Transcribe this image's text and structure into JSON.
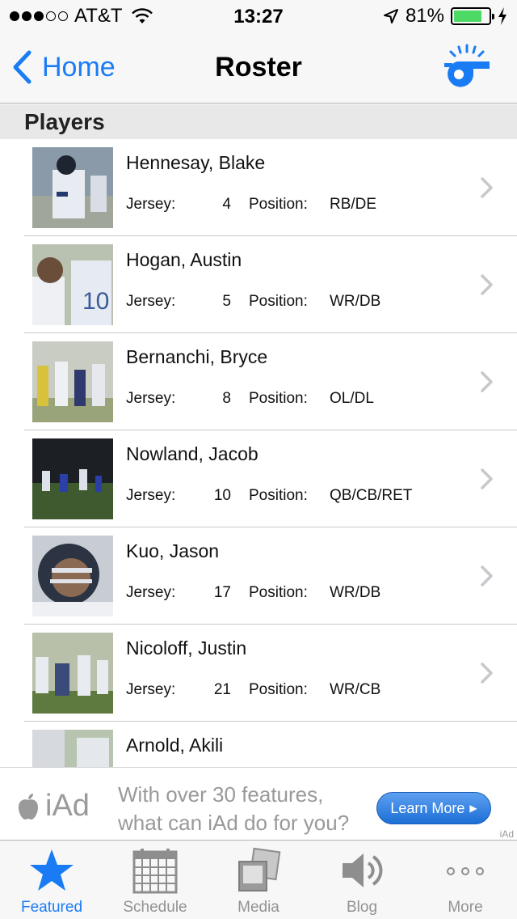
{
  "status_bar": {
    "carrier": "AT&T",
    "time": "13:27",
    "battery_percent": "81%",
    "battery_level": 0.81,
    "signal_bars": 3,
    "signal_total": 5
  },
  "nav": {
    "back_label": "Home",
    "title": "Roster",
    "right_icon": "whistle-icon",
    "accent_color": "#1a7cf5"
  },
  "section": {
    "title": "Players"
  },
  "labels": {
    "jersey": "Jersey:",
    "position": "Position:"
  },
  "players": [
    {
      "name": "Hennesay, Blake",
      "jersey": "4",
      "position": "RB/DE"
    },
    {
      "name": "Hogan, Austin",
      "jersey": "5",
      "position": "WR/DB"
    },
    {
      "name": "Bernanchi, Bryce",
      "jersey": "8",
      "position": "OL/DL"
    },
    {
      "name": "Nowland, Jacob",
      "jersey": "10",
      "position": "QB/CB/RET"
    },
    {
      "name": "Kuo, Jason",
      "jersey": "17",
      "position": "WR/DB"
    },
    {
      "name": "Nicoloff, Justin",
      "jersey": "21",
      "position": "WR/CB"
    },
    {
      "name": "Arnold, Akili",
      "jersey": "",
      "position": ""
    }
  ],
  "ad": {
    "brand": "iAd",
    "text": "With over 30 features, what can iAd do for you?",
    "button_label": "Learn More",
    "tag": "iAd"
  },
  "tabs": [
    {
      "label": "Featured",
      "icon": "star-icon",
      "active": true
    },
    {
      "label": "Schedule",
      "icon": "calendar-icon",
      "active": false
    },
    {
      "label": "Media",
      "icon": "media-icon",
      "active": false
    },
    {
      "label": "Blog",
      "icon": "speaker-icon",
      "active": false
    },
    {
      "label": "More",
      "icon": "more-icon",
      "active": false
    }
  ]
}
